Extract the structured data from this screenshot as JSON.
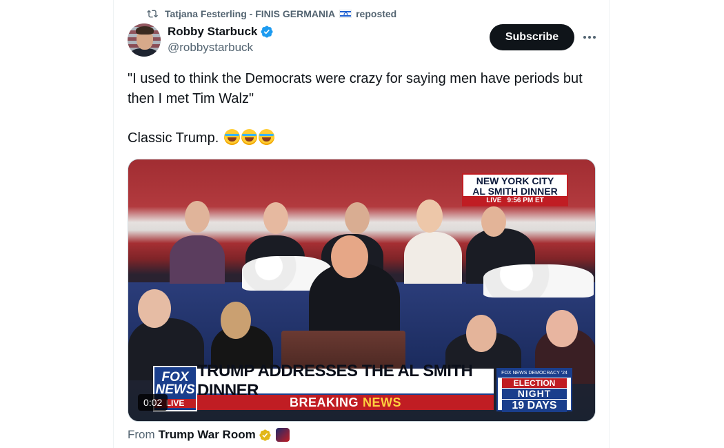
{
  "repost": {
    "user_name": "Tatjana Festerling - FINIS GERMANIA",
    "action": "reposted",
    "flag_icon": "israel-flag-icon"
  },
  "author": {
    "name": "Robby Starbuck",
    "handle": "@robbystarbuck",
    "verified_icon": "verified-badge-icon",
    "verified_color": "#1d9bf0"
  },
  "actions": {
    "subscribe_label": "Subscribe",
    "more_icon": "more-dots-icon"
  },
  "tweet": {
    "line1": "\"I used to think the Democrats were crazy for saying men have periods but then I met Tim Walz\"",
    "line2": "Classic Trump.",
    "emoji": [
      "face-with-tears-of-joy",
      "face-with-tears-of-joy",
      "face-with-tears-of-joy"
    ]
  },
  "video": {
    "location_line1": "NEW YORK CITY",
    "location_line2": "AL SMITH DINNER",
    "live_label": "LIVE",
    "time_label": "9:56 PM ET",
    "network_line1": "FOX",
    "network_line2": "NEWS",
    "network_live": "LIVE",
    "headline": "TRUMP ADDRESSES THE AL SMITH DINNER",
    "breaking_part1": "BREAKING",
    "breaking_part2": "NEWS",
    "election_top": "FOX NEWS DEMOCRACY '24",
    "election_line1": "ELECTION",
    "election_line2": "NIGHT",
    "election_line3": "19 DAYS",
    "timestamp": "0:02"
  },
  "source": {
    "prefix": "From",
    "name": "Trump War Room",
    "badge_icon": "gold-verified-badge-icon",
    "badge_color": "#e2b719"
  },
  "colors": {
    "text_primary": "#0f1419",
    "text_secondary": "#536471",
    "fox_red": "#c01d23",
    "fox_blue": "#1a3e8c"
  }
}
